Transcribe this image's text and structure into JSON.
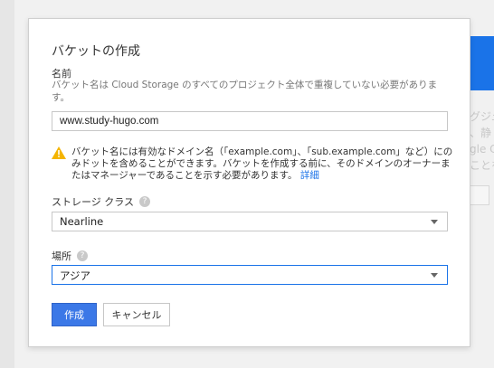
{
  "background": {
    "right_text": "グジュ\n、静\ngle C\nことを"
  },
  "dialog": {
    "title": "バケットの作成",
    "name_label": "名前",
    "name_help": "バケット名は Cloud Storage のすべてのプロジェクト全体で重複していない必要があります。",
    "name_value": "www.study-hugo.com",
    "warning_text": "バケット名には有効なドメイン名（「example.com」、「sub.example.com」など）にのみドットを含めることができます。バケットを作成する前に、そのドメインのオーナーまたはマネージャーであることを示す必要があります。",
    "warning_link": "詳細",
    "storage_class_label": "ストレージ クラス",
    "storage_class_value": "Nearline",
    "location_label": "場所",
    "location_value": "アジア",
    "create_button": "作成",
    "cancel_button": "キャンセル"
  },
  "icons": {
    "warning": "warning-icon",
    "help": "help-icon",
    "dropdown": "chevron-down-icon"
  },
  "colors": {
    "primary": "#3b78e7",
    "link": "#1a73e8",
    "warning": "#f4b400"
  }
}
